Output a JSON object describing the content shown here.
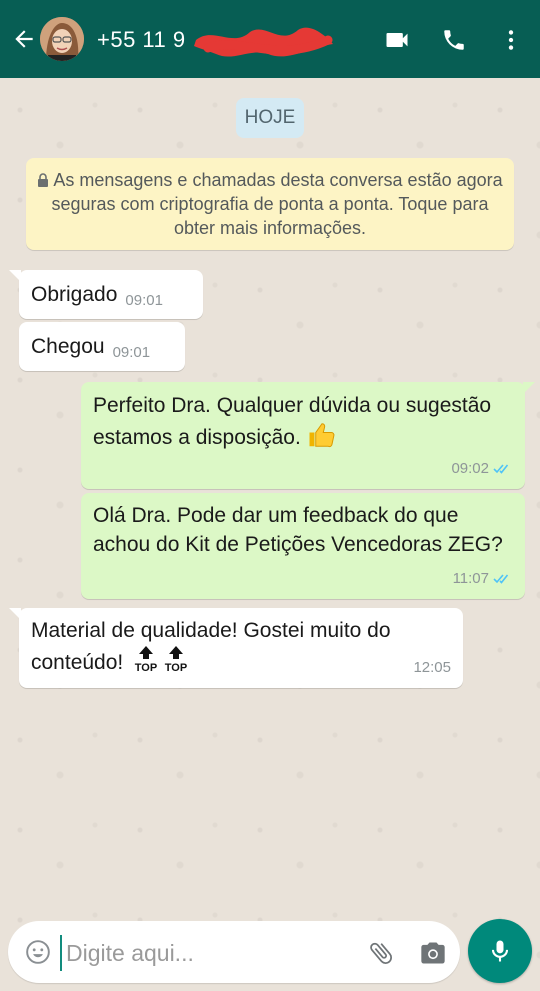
{
  "header": {
    "contact_name": "+55 11 9",
    "icons": [
      "back-arrow-icon",
      "video-call-icon",
      "voice-call-icon",
      "more-vert-icon"
    ],
    "header_color": "#075e54"
  },
  "date_chip": "HOJE",
  "encryption_notice": "As mensagens e chamadas desta conversa estão agora seguras com criptografia de ponta a ponta. Toque para obter mais informações.",
  "messages": [
    {
      "direction": "in",
      "text": "Obrigado",
      "time": "09:01"
    },
    {
      "direction": "in",
      "text": "Chegou",
      "time": "09:01"
    },
    {
      "direction": "out",
      "text": "Perfeito Dra. Qualquer dúvida ou sugestão estamos a disposição.",
      "emoji": "thumbs-up",
      "time": "09:02",
      "status": "read"
    },
    {
      "direction": "out",
      "text": "Olá Dra. Pode dar um feedback do que achou do Kit de Petições Vencedoras ZEG?",
      "time": "11:07",
      "status": "read"
    },
    {
      "direction": "in",
      "text": "Material de qualidade! Gostei muito do conteúdo!",
      "emoji": "top-arrow x2",
      "time": "12:05"
    }
  ],
  "emoji_top_label": "TOP",
  "composer": {
    "placeholder": "Digite aqui...",
    "icons": [
      "emoji-icon",
      "paperclip-icon",
      "camera-icon",
      "mic-icon"
    ]
  },
  "colors": {
    "incoming_bubble": "#ffffff",
    "outgoing_bubble": "#dcf8c6",
    "read_ticks": "#4fc3f7",
    "accent": "#00897b"
  }
}
